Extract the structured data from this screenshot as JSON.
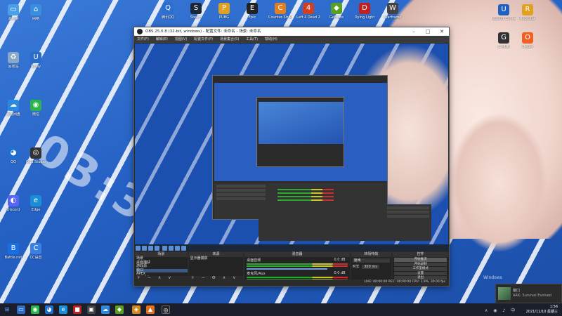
{
  "desktop": {
    "left_icons": [
      {
        "label": "此电脑",
        "color": "#4aa0e8",
        "glyph": "▭"
      },
      {
        "label": "网络",
        "color": "#3a8ee0",
        "glyph": "⌂"
      },
      {
        "label": "回收站",
        "color": "#8aa8c8",
        "glyph": "♻"
      },
      {
        "label": "Uplay",
        "color": "#2a6cc8",
        "glyph": "U"
      },
      {
        "label": "百度网盘",
        "color": "#2b8ae0",
        "glyph": "☁"
      },
      {
        "label": "微信",
        "color": "#2bb44a",
        "glyph": "◉"
      },
      {
        "label": "QQ",
        "color": "#1f6fd0",
        "glyph": "◕"
      },
      {
        "label": "OBS Studio",
        "color": "#333333",
        "glyph": "◎"
      },
      {
        "label": "Discord",
        "color": "#5865f2",
        "glyph": "◐"
      },
      {
        "label": "Edge",
        "color": "#1a8fd8",
        "glyph": "e"
      },
      {
        "label": "Battle.net",
        "color": "#1a6fe0",
        "glyph": "B"
      },
      {
        "label": "CC语音",
        "color": "#3a80e0",
        "glyph": "C"
      }
    ],
    "top_icons": [
      {
        "label": "腾讯QQ",
        "color": "#2b6fd0",
        "glyph": "Q"
      },
      {
        "label": "Steam",
        "color": "#1b2838",
        "glyph": "S"
      },
      {
        "label": "PUBG",
        "color": "#e0a020",
        "glyph": "P"
      },
      {
        "label": "Epic",
        "color": "#222222",
        "glyph": "E"
      },
      {
        "label": "Counter-Strike",
        "color": "#e08020",
        "glyph": "C"
      },
      {
        "label": "Left 4 Dead 2",
        "color": "#d04020",
        "glyph": "4"
      },
      {
        "label": "GeForce",
        "color": "#5aa020",
        "glyph": "◆"
      },
      {
        "label": "Dying Light",
        "color": "#c02020",
        "glyph": "D"
      },
      {
        "label": "Warframe",
        "color": "#444444",
        "glyph": "W"
      }
    ],
    "right_icons": [
      {
        "label": "Ubisoft Connect",
        "color": "#2060c0",
        "glyph": "U"
      },
      {
        "label": "Rockstar",
        "color": "#e0a020",
        "glyph": "R"
      },
      {
        "label": "G HUB",
        "color": "#333333",
        "glyph": "G"
      },
      {
        "label": "Origin",
        "color": "#f06020",
        "glyph": "O"
      }
    ],
    "watermark": "Windows"
  },
  "obs": {
    "title": "OBS 25.0.8 (32-bit, windows) - 配置文件: 未命名 - 场景: 未命名",
    "menu": [
      "文件(F)",
      "编辑(E)",
      "视图(V)",
      "配置文件(P)",
      "场景集合(S)",
      "工具(T)",
      "帮助(H)"
    ],
    "docks": {
      "scenes": {
        "title": "场景",
        "items": [
          "场景",
          "桌面捕获",
          "游戏源",
          "窗口",
          "APEX",
          "绝地求生",
          "直播中"
        ],
        "selected": 3
      },
      "sources": {
        "title": "来源",
        "items": [
          "显示器捕获"
        ]
      },
      "mixer": {
        "title": "混音器",
        "channels": [
          {
            "name": "桌面音频",
            "db": "0.0 dB"
          },
          {
            "name": "麦克风/Aux",
            "db": "0.0 dB"
          }
        ]
      },
      "transitions": {
        "title": "转场特效",
        "type": "淡出",
        "duration_label": "时长",
        "duration": "300 ms"
      },
      "controls": {
        "title": "控件",
        "buttons": [
          "开始推流",
          "开始录制",
          "工作室模式",
          "设置",
          "退出"
        ],
        "active": 0
      }
    },
    "status": "LIVE: 00:00:00   REC: 00:00:00   CPU: 1.9%, 30.00 fps"
  },
  "notification": {
    "title": "窗口",
    "subtitle": "ARK: Survival Evolved"
  },
  "taskbar": {
    "time": "1:56",
    "date": "2021/11/10 星期三"
  }
}
